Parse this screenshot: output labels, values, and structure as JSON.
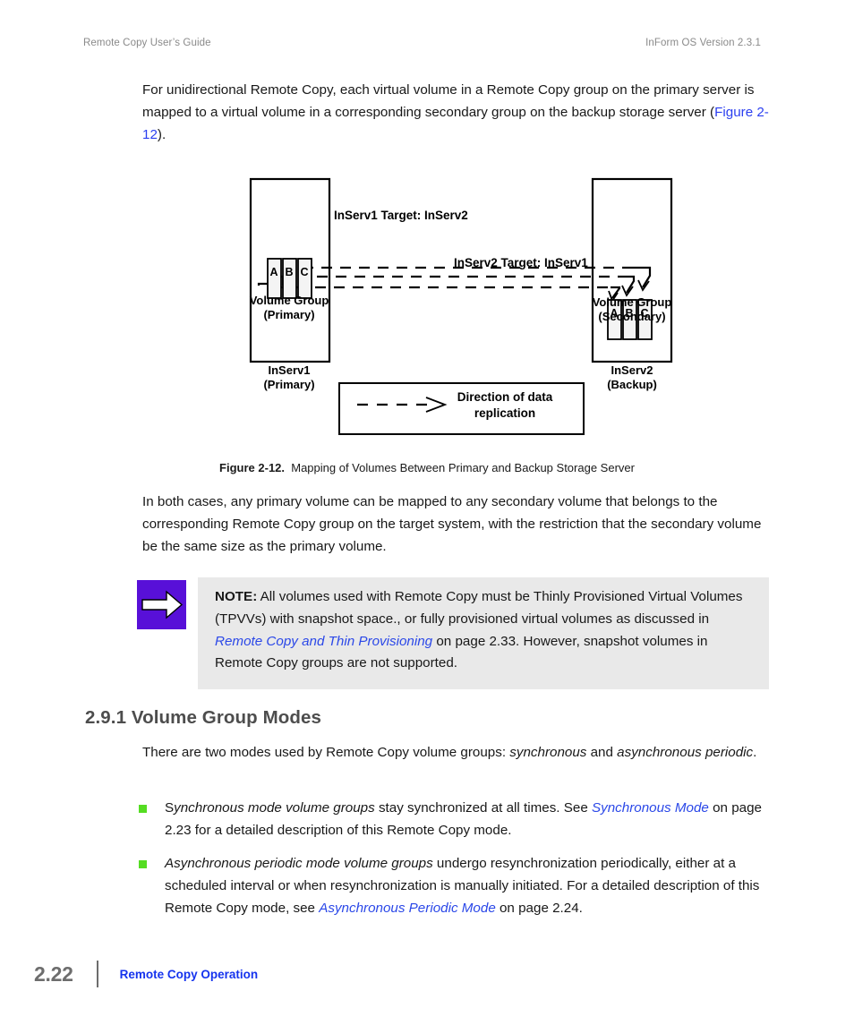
{
  "header": {
    "left": "Remote Copy User’s Guide",
    "right": "InForm OS Version 2.3.1"
  },
  "intro_paragraph": {
    "part1": "For unidirectional Remote Copy, each virtual volume in a Remote Copy group on the primary server is mapped to a virtual volume in a corresponding secondary group on the backup storage server (",
    "figure_link": "Figure 2-12",
    "part2": ")."
  },
  "figure": {
    "left_box": {
      "group_label_line1": "Volume Group",
      "group_label_line2": "(Primary)",
      "volumes": [
        "A",
        "B",
        "C"
      ],
      "caption_line1": "InServ1",
      "caption_line2": "(Primary)"
    },
    "right_box": {
      "group_label_line1": "Volume Group",
      "group_label_line2": "(Secondary)",
      "volumes": [
        "A",
        "B",
        "C"
      ],
      "caption_line1": "InServ2",
      "caption_line2": "(Backup)"
    },
    "link_label_top": "InServ1 Target: InServ2",
    "link_label_bottom": "InServ2 Target: InServ1",
    "legend": {
      "line1": "Direction of data",
      "line2": "replication"
    },
    "caption_label": "Figure 2-12.",
    "caption_text": "Mapping of Volumes Between Primary and Backup Storage Server"
  },
  "both_cases_paragraph": "In both cases, any primary volume can be mapped to any secondary volume that belongs to the corresponding Remote Copy group on the target system, with the restriction that the secondary volume be the same size as the primary volume.",
  "note": {
    "label": "NOTE:",
    "part1": " All volumes used with Remote Copy must be Thinly Provisioned Virtual Volumes (TPVVs) with snapshot space., or fully provisioned virtual volumes as discussed in ",
    "link": "Remote Copy and Thin Provisioning",
    "part2": " on page 2.33. However, snapshot volumes in Remote Copy groups are not supported.",
    "icon": "right-arrow-icon",
    "icon_color": "#5810d8",
    "background_color": "#e9e9e9"
  },
  "section": {
    "heading": "2.9.1 Volume Group Modes",
    "intro_part1": "There are two modes used by Remote Copy volume groups: ",
    "intro_italic1": "synchronous",
    "intro_part2": " and ",
    "intro_italic2": "asynchronous periodic",
    "intro_part3": "."
  },
  "bullets": [
    {
      "italic_lead": "S",
      "italic_rest": "ynchronous mode volume groups",
      "mid": " stay synchronized at all times. See ",
      "link": "Synchronous Mode",
      "tail": " on page 2.23 for a detailed description of this Remote Copy mode."
    },
    {
      "italic_lead": "",
      "italic_rest": "Asynchronous periodic mode volume groups",
      "mid": " undergo resynchronization periodically, either at a scheduled interval or when resynchronization is manually initiated. For a detailed description of this Remote Copy mode, see ",
      "link": "Asynchronous Periodic Mode",
      "tail": " on page 2.24."
    }
  ],
  "footer": {
    "page_number": "2.22",
    "section_title": "Remote Copy Operation"
  },
  "colors": {
    "link_blue": "#2b3ff0",
    "footer_blue": "#1533ee",
    "bullet_green": "#55dd22",
    "note_purple": "#5810d8",
    "heading_gray": "#4d4d4d"
  }
}
